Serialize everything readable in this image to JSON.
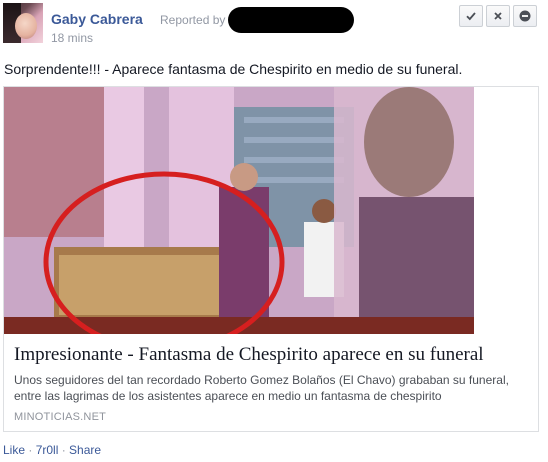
{
  "post": {
    "author": "Gaby Cabrera",
    "reported_prefix": "Reported by",
    "time": "18 mins",
    "message": "Sorprendente!!! - Aparece fantasma de Chespirito en medio de su funeral."
  },
  "actions": {
    "approve_icon": "check-icon",
    "delete_icon": "close-icon",
    "block_icon": "minus-circle-icon"
  },
  "card": {
    "title": "Impresionante - Fantasma de Chespirito aparece en su funeral",
    "description": "Unos seguidores del tan recordado Roberto Gomez Bolaños (El Chavo) grababan su funeral, entre las lagrimas de los asistentes aparece en medio un fantasma de chespirito",
    "domain": "MINOTICIAS.NET"
  },
  "footer": {
    "like": "Like",
    "sep1": " · ",
    "user": "7r0ll",
    "sep2": " · ",
    "share": "Share"
  },
  "colors": {
    "link": "#3b5998",
    "meta": "#9197a3",
    "circle": "#d61f1f"
  }
}
